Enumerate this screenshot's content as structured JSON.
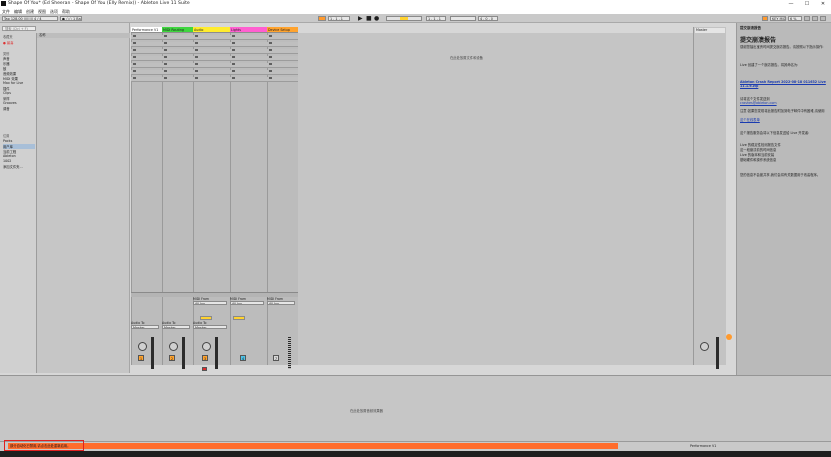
{
  "window": {
    "title": "Shape Of You* (Ed Sheeran - Shape Of You (Elly Remix)) - Ableton Live 11 Suite",
    "minimize": "—",
    "maximize": "☐",
    "close": "✕"
  },
  "menu": [
    "文件",
    "编辑",
    "创建",
    "视图",
    "选项",
    "帮助"
  ],
  "transport": {
    "tempo": "Tap 128.00 ||||||||  4 / 4",
    "metronome": "● ○○ 1 Bar",
    "position": "1 . 1 . 1",
    "loop_start": "1 . 1 . 1",
    "loop_length": "4 . 0 . 0",
    "key_midi_label": "KEY MIDI",
    "cpu": "6 %",
    "play": "▶",
    "stop": "■",
    "record": "●"
  },
  "browser": {
    "search_placeholder": "搜索 (Ctrl + F)",
    "collections_header": "收藏夹",
    "collections": [
      "● 最喜"
    ],
    "library_header": "类别",
    "categories": [
      "声音",
      "乐器",
      "鼓",
      "音频效果",
      "MIDI 效果",
      "Max for Live",
      "插件",
      "Clips",
      "采样",
      "Grooves",
      "调音"
    ],
    "places_header": "位置",
    "places": [
      "Packs",
      "用户库",
      "当前工程",
      "Ableton",
      "1002",
      "添加文件夹..."
    ],
    "list_header": "名称"
  },
  "tracks": [
    {
      "name": "Performance V1",
      "color": "#ffffff"
    },
    {
      "name": "MIDI Routing",
      "color": "#3fd63f"
    },
    {
      "name": "Audio",
      "color": "#ffec2e"
    },
    {
      "name": "Lights",
      "color": "#ff5fd0"
    },
    {
      "name": "Device Setup",
      "color": "#ffa32e"
    }
  ],
  "session_drop_message": "在此处放置文件和设备",
  "master_label": "Master",
  "help": {
    "panel_title": "提交崩溃报告",
    "heading": "提交崩溃报告",
    "paragraph1": "感谢您抽出宝贵时间提交崩溃报告。请按照以下指示操作:",
    "paragraph2": "Live 创建了一个崩溃报告。将其命名为:",
    "report_file": "Ableton Crash Report 2022-08-18 011632 Live 11.1.6.zip",
    "paragraph3": "请将这个文件发送到",
    "email": "crashes@ableton.com",
    "paragraph4": "注意:如果您发现将此报告附加到电子邮件中有困难,请使用",
    "upload_link": "这个在线表单",
    "paragraph5": "这个报告服务会将以下信息发送给 Live 开发者:",
    "bullets": [
      "Live 的稳定性检测报告文件",
      "这一段崩溃前的时间信息",
      "Live 的版本和当前安装",
      "基础硬件和操作系统信息"
    ],
    "paragraph6": "您的信息不会被共享,我们会将有关数据用于改善程序。"
  },
  "mixer": {
    "audio_to": "Audio To",
    "master_out": "Master",
    "midi_from": "MIDI From",
    "all_ins": "All Ins",
    "track_numbers": [
      "1",
      "2",
      "3",
      "4",
      "7"
    ],
    "volume_db": [
      "-inf",
      "-inf",
      "-inf",
      "-inf",
      "-inf"
    ]
  },
  "detail_drop_message": "在此处放置音频效果器",
  "status": {
    "message": "部分自动化已禁用,请点击此处重新启用。",
    "right_label": "Performance V1"
  }
}
